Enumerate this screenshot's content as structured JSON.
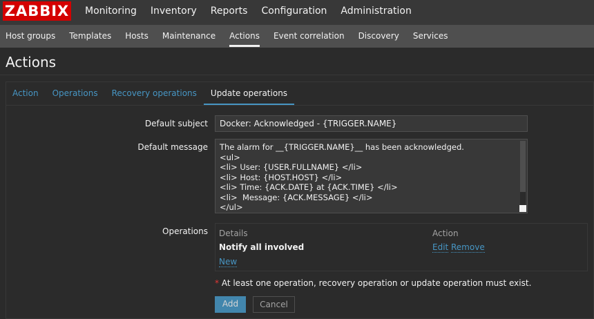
{
  "app": {
    "logo": "ZABBIX"
  },
  "main_menu": [
    {
      "label": "Monitoring"
    },
    {
      "label": "Inventory"
    },
    {
      "label": "Reports"
    },
    {
      "label": "Configuration"
    },
    {
      "label": "Administration"
    }
  ],
  "sub_menu": [
    {
      "label": "Host groups"
    },
    {
      "label": "Templates"
    },
    {
      "label": "Hosts"
    },
    {
      "label": "Maintenance"
    },
    {
      "label": "Actions",
      "active": true
    },
    {
      "label": "Event correlation"
    },
    {
      "label": "Discovery"
    },
    {
      "label": "Services"
    }
  ],
  "page": {
    "title": "Actions"
  },
  "tabs": [
    {
      "label": "Action"
    },
    {
      "label": "Operations"
    },
    {
      "label": "Recovery operations"
    },
    {
      "label": "Update operations",
      "active": true
    }
  ],
  "form": {
    "subject_label": "Default subject",
    "subject_value": "Docker: Acknowledged - {TRIGGER.NAME}",
    "message_label": "Default message",
    "message_lines": [
      "The alarm for __{TRIGGER.NAME}__ has been acknowledged.",
      "<ul>",
      "<li> User: {USER.FULLNAME} </li>",
      "<li> Host: {HOST.HOST} </li>",
      "<li> Time: {ACK.DATE} at {ACK.TIME} </li>",
      "<li>  Message: {ACK.MESSAGE} </li>",
      "</ul>"
    ],
    "operations_label": "Operations",
    "operations": {
      "col_details": "Details",
      "col_action": "Action",
      "row_details": "Notify all involved",
      "edit": "Edit",
      "remove": "Remove",
      "new": "New"
    },
    "warning_star": "*",
    "warning_text": "At least one operation, recovery operation or update operation must exist.",
    "add_label": "Add",
    "cancel_label": "Cancel"
  },
  "colors": {
    "brand": "#d40000",
    "link": "#4796c4",
    "background": "#2b2b2b",
    "warning_star": "#e33734"
  }
}
